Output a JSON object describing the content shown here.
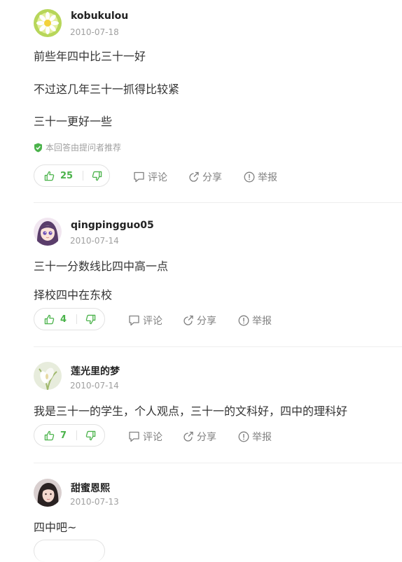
{
  "answers": [
    {
      "username": "kobukulou",
      "date": "2010-07-18",
      "lines": [
        "前些年四中比三十一好",
        "不过这几年三十一抓得比较紧",
        "三十一更好一些"
      ],
      "recommend": "本回答由提问者推荐",
      "likes": "25"
    },
    {
      "username": "qingpingguo05",
      "date": "2010-07-14",
      "lines": [
        "三十一分数线比四中高一点",
        "择校四中在东校"
      ],
      "likes": "4"
    },
    {
      "username": "莲光里的梦",
      "date": "2010-07-14",
      "lines": [
        "我是三十一的学生，个人观点，三十一的文科好，四中的理科好"
      ],
      "likes": "7"
    },
    {
      "username": "甜蜜恩熙",
      "date": "2010-07-13",
      "lines": [
        "四中吧~"
      ]
    }
  ],
  "actions": {
    "comment": "评论",
    "share": "分享",
    "report": "举报"
  },
  "colors": {
    "like_green": "#4bb34b",
    "gray_text": "#808080",
    "divider": "#eeeeee"
  }
}
